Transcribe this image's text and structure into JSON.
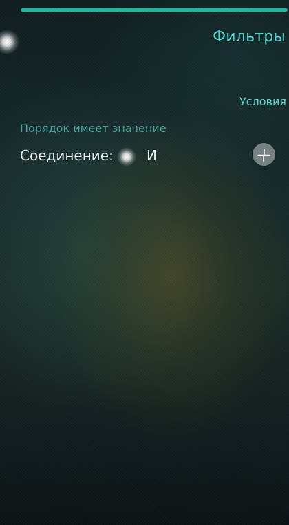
{
  "header": {
    "title": "Фильтры"
  },
  "conditions": {
    "section_title": "Условия",
    "order_matters_label": "Порядок имеет значение",
    "join_label": "Соединение:",
    "join_value": "И",
    "add_icon": "plus-icon"
  },
  "colors": {
    "accent": "#5dd8d0",
    "secondary_accent": "#49a6a1",
    "top_bar": "#22b7a3",
    "primary_text": "#eef2f2"
  }
}
